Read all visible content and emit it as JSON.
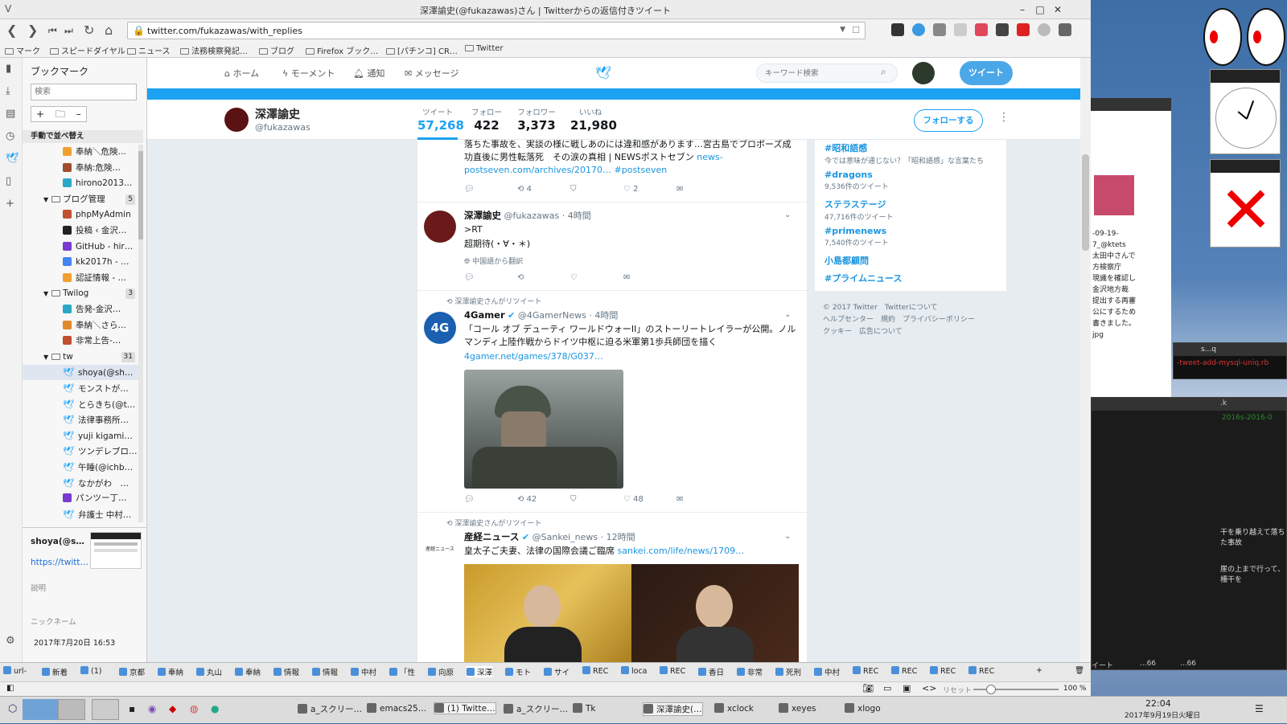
{
  "window": {
    "title": "深澤諭史(@fukazawas)さん | Twitterからの返信付きツイート"
  },
  "address": {
    "url": "twitter.com/fukazawas/with_replies"
  },
  "bookmarks_bar": [
    "マーク",
    "スピードダイヤル",
    "ニュース",
    "法務検察発記…",
    "ブログ",
    "Firefox ブック…",
    "[パチンコ] CR…",
    "Twitter"
  ],
  "sidebar": {
    "title": "ブックマーク",
    "search_placeholder": "検索",
    "sort_label": "手動で並べ替え",
    "items": [
      {
        "label": "奉納＼危険…",
        "kind": "leaf"
      },
      {
        "label": "奉納:危険…",
        "kind": "leaf"
      },
      {
        "label": "hirono2013…",
        "kind": "leaf"
      },
      {
        "label": "ブログ管理",
        "kind": "folder",
        "count": "5"
      },
      {
        "label": "phpMyAdmin",
        "kind": "leaf"
      },
      {
        "label": "投稿 ‹ 金沢…",
        "kind": "leaf"
      },
      {
        "label": "GitHub - hir…",
        "kind": "leaf"
      },
      {
        "label": "kk2017h - …",
        "kind": "leaf"
      },
      {
        "label": "認証情報 - …",
        "kind": "leaf"
      },
      {
        "label": "Twilog",
        "kind": "folder",
        "count": "3"
      },
      {
        "label": "告発-金沢…",
        "kind": "leaf"
      },
      {
        "label": "奉納＼さら…",
        "kind": "leaf"
      },
      {
        "label": "非常上告-…",
        "kind": "leaf"
      },
      {
        "label": "tw",
        "kind": "folder",
        "count": "31"
      },
      {
        "label": "shoya(@sh…",
        "kind": "tw"
      },
      {
        "label": "モンストが…",
        "kind": "tw"
      },
      {
        "label": "とらきち(@t…",
        "kind": "tw"
      },
      {
        "label": "法律事務所…",
        "kind": "tw"
      },
      {
        "label": "yuji kigami…",
        "kind": "tw"
      },
      {
        "label": "ツンデレブロ…",
        "kind": "tw"
      },
      {
        "label": "午睡(@ichb…",
        "kind": "tw"
      },
      {
        "label": "なかがわ　…",
        "kind": "tw"
      },
      {
        "label": "パンツー丁…",
        "kind": "leaf"
      },
      {
        "label": "弁護士 中村…",
        "kind": "tw"
      }
    ],
    "detail": {
      "name": "shoya(@s…",
      "url": "https://twitt…",
      "desc_label": "説明",
      "nick_label": "ニックネーム",
      "date": "2017年7月20日 16:53"
    }
  },
  "twitter_nav": {
    "home": "ホーム",
    "moments": "モーメント",
    "notifications": "通知",
    "messages": "メッセージ",
    "search_placeholder": "キーワード検索",
    "tweet_button": "ツイート"
  },
  "profile": {
    "name": "深澤諭史",
    "handle": "@fukazawas",
    "stats": [
      {
        "label": "ツイート",
        "value": "57,268"
      },
      {
        "label": "フォロー",
        "value": "422"
      },
      {
        "label": "フォロワー",
        "value": "3,373"
      },
      {
        "label": "いいね",
        "value": "21,980"
      }
    ],
    "follow_button": "フォローする"
  },
  "tweets": [
    {
      "partial_text": "落ちた事故を、実談の様に戦しあのには違和感があります…宮古島でプロポーズ成功直後に男性転落死　その涙の真相 | NEWSポストセブン",
      "link": "news-postseven.com/archives/20170…",
      "hashtag": "#postseven",
      "retweets": "4",
      "likes": "2"
    },
    {
      "name": "深澤諭史",
      "handle": "@fukazawas",
      "time": "· 4時間",
      "line1": ">RT",
      "line2": "超期待(・∀・＊)",
      "translate": "中国語から翻訳"
    },
    {
      "rt_label": "深澤諭史さんがリツイート",
      "name": "4Gamer",
      "handle": "@4GamerNews",
      "time": "· 4時間",
      "text": "「コール オブ デューティ ワールドウォーII」のストーリートレイラーが公開。ノルマンディ上陸作戦からドイツ中枢に迫る米軍第1歩兵師団を描く",
      "link": "4gamer.net/games/378/G037…",
      "retweets": "42",
      "likes": "48"
    },
    {
      "rt_label": "深澤諭史さんがリツイート",
      "name": "産経ニュース",
      "handle": "@Sankei_news",
      "time": "· 12時間",
      "text": "皇太子ご夫妻、法律の国際会議ご臨席",
      "link": "sankei.com/life/news/1709…",
      "avatar_text": "産經ニュース"
    }
  ],
  "trends": [
    {
      "name": "#昭和語感",
      "count": "今では意味が通じない？「昭和語感」な言葉たち"
    },
    {
      "name": "#dragons",
      "count": "9,536件のツイート"
    },
    {
      "name": "ステラステージ",
      "count": "47,716件のツイート"
    },
    {
      "name": "#primenews",
      "count": "7,540件のツイート"
    },
    {
      "name": "小島都顧問",
      "count": ""
    },
    {
      "name": "#プライムニュース",
      "count": ""
    }
  ],
  "footer": {
    "line1": "© 2017 Twitter　Twitterについて",
    "line2": "ヘルプセンター　規約　プライバシーポリシー",
    "line3": "クッキー　広告について"
  },
  "browser_tabs": [
    "url-",
    "新着",
    "(1)",
    "京都",
    "奉納",
    "丸山",
    "奉納",
    "情報",
    "情報",
    "中村",
    "「性",
    "向原",
    "深澤",
    "モト",
    "サイ",
    "REC",
    "loca",
    "REC",
    "香日",
    "非常",
    "死刑",
    "中村",
    "REC",
    "REC",
    "REC",
    "REC"
  ],
  "status": {
    "reset_label": "リセット",
    "zoom": "100 %"
  },
  "os_panel": {
    "tasks": [
      "a_スクリー…",
      "emacs25…",
      "(1) Twitte…",
      "a_スクリー…",
      "Tk",
      "深澤諭史(…",
      "xclock",
      "xeyes",
      "xlogo"
    ],
    "time": "22:04",
    "date": "2017年9月19日火曜日"
  },
  "desktop": {
    "terminal_lines": [
      "-09-19-",
      "7_@ktets",
      "太田中さんで",
      "方検察庁",
      "現識を確認し",
      "金沢地方裁",
      "提出する再審",
      "公にするため",
      "書きました。",
      "jpg"
    ],
    "term2_text": "-tweet-add-mysql-uniq.rb",
    "term3_text": "2016s-2016-0",
    "lower_lines": [
      "干を乗り越えて落ちた事故",
      "崖の上まで行って、柵干を"
    ],
    "small_tabs": [
      "s...q",
      ".k",
      "イート",
      "...66",
      "...66"
    ]
  }
}
